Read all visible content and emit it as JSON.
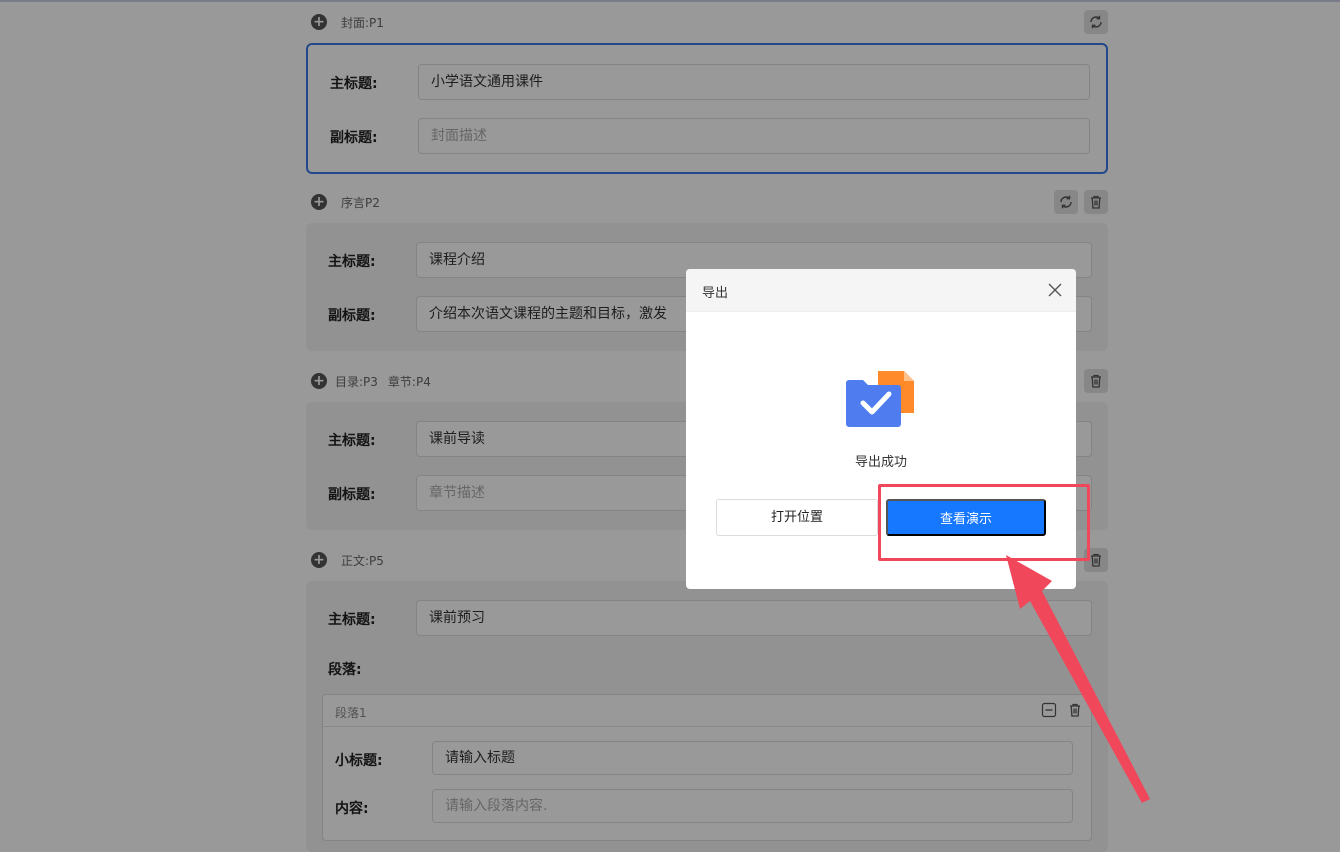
{
  "sections": [
    {
      "label": "封面:P1",
      "fields": [
        {
          "label": "主标题:",
          "value": "小学语文通用课件",
          "placeholder": ""
        },
        {
          "label": "副标题:",
          "value": "",
          "placeholder": "封面描述"
        }
      ]
    },
    {
      "label": "序言P2",
      "fields": [
        {
          "label": "主标题:",
          "value": "课程介绍",
          "placeholder": ""
        },
        {
          "label": "副标题:",
          "value": "介绍本次语文课程的主题和目标，激发",
          "placeholder": ""
        }
      ]
    },
    {
      "label": "目录:P3",
      "label2": "章节:P4",
      "fields": [
        {
          "label": "主标题:",
          "value": "课前导读",
          "placeholder": ""
        },
        {
          "label": "副标题:",
          "value": "",
          "placeholder": "章节描述"
        }
      ]
    },
    {
      "label": "正文:P5",
      "fields": [
        {
          "label": "主标题:",
          "value": "课前预习",
          "placeholder": ""
        }
      ],
      "paragraphs_label": "段落:",
      "paragraph": {
        "title": "段落1",
        "fields": [
          {
            "label": "小标题:",
            "value": "请输入标题"
          },
          {
            "label": "内容:",
            "value": "",
            "placeholder": "请输入段落内容."
          }
        ]
      }
    }
  ],
  "dialog": {
    "title": "导出",
    "message": "导出成功",
    "open_location_label": "打开位置",
    "view_demo_label": "查看演示",
    "icon": "folder-check-icon"
  },
  "colors": {
    "primary": "#1677ff",
    "active_border": "#3a78e6",
    "annotation": "#f0475a",
    "folder_blue": "#4f7df0",
    "file_orange": "#ff8a2a"
  }
}
